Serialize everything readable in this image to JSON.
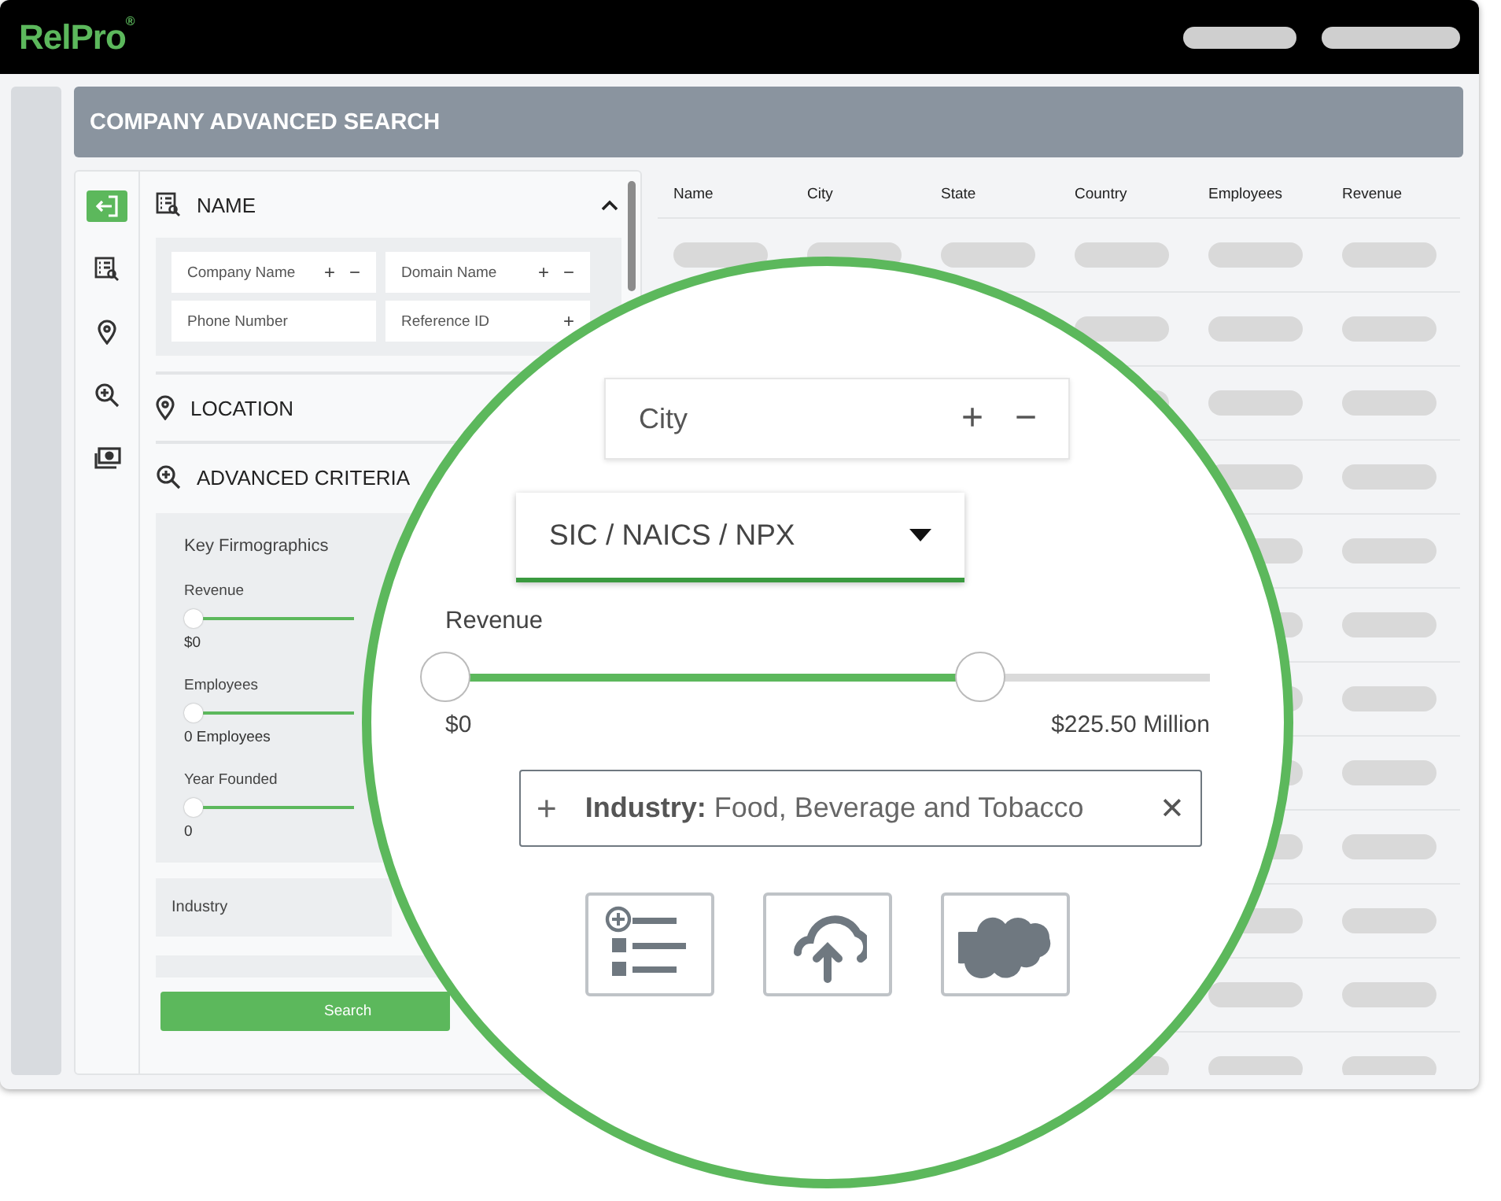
{
  "header": {
    "logo": "RelPro",
    "logo_mark": "®"
  },
  "page_title": "COMPANY ADVANCED SEARCH",
  "nav_icons": [
    {
      "kind": "exit",
      "selected": true
    },
    {
      "kind": "list",
      "selected": false
    },
    {
      "kind": "pin",
      "selected": false
    },
    {
      "kind": "zoom",
      "selected": false
    },
    {
      "kind": "money",
      "selected": false
    }
  ],
  "name_section": {
    "title": "NAME",
    "expanded": true,
    "fields": [
      {
        "label": "Company Name",
        "actions": [
          "+",
          "−"
        ]
      },
      {
        "label": "Domain Name",
        "actions": [
          "+",
          "−"
        ]
      },
      {
        "label": "Phone Number"
      },
      {
        "label": "Reference ID",
        "actions": [
          "+"
        ]
      }
    ]
  },
  "location_section": {
    "title": "LOCATION"
  },
  "advanced_section": {
    "title": "ADVANCED CRITERIA"
  },
  "firmographics": {
    "title": "Key Firmographics",
    "sliders": [
      {
        "label": "Revenue",
        "level": 0,
        "reading": "$0"
      },
      {
        "label": "Employees",
        "level": 0,
        "reading": "0 Employees"
      },
      {
        "label": "Year Founded",
        "level": 0,
        "reading": "0"
      }
    ]
  },
  "industry_box": "Industry",
  "search_button": "Search",
  "table": {
    "columns": [
      "Name",
      "City",
      "State",
      "Country",
      "Employees",
      "Revenue"
    ]
  },
  "magnifier": {
    "city_field": {
      "label": "City",
      "actions": [
        "+",
        "−"
      ]
    },
    "code_dropdown": "SIC / NAICS / NPX",
    "revenue": {
      "label": "Revenue",
      "level": 0.7,
      "min_reading": "$0",
      "max_reading": "$225.50 Million"
    },
    "industry_chip": {
      "add": "+",
      "key": "Industry:",
      "value": "Food, Beverage and Tobacco",
      "remove": "✕"
    },
    "tools": [
      {
        "kind": "add-list"
      },
      {
        "kind": "upload"
      },
      {
        "kind": "cloud"
      }
    ]
  }
}
